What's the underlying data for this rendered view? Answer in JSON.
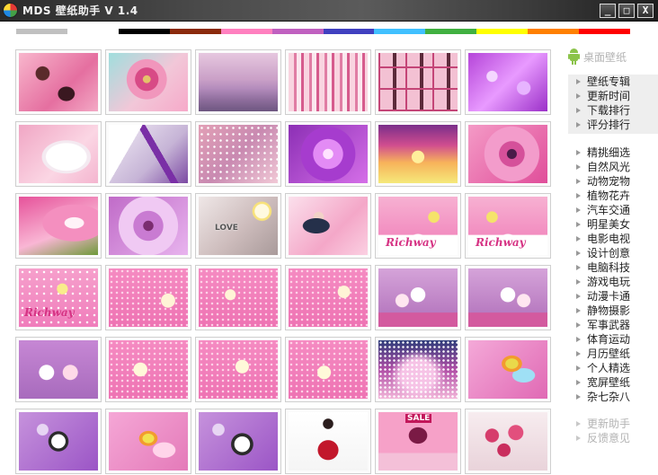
{
  "window": {
    "title": "MDS 壁纸助手 V 1.4",
    "controls": [
      "_",
      "□",
      "X"
    ]
  },
  "color_filter": [
    "#c0c0c0",
    "#ffffff",
    "#000000",
    "#8b2a0c",
    "#ff80bf",
    "#c060c0",
    "#4040c0",
    "#40c0ff",
    "#40b040",
    "#ffff00",
    "#ff8000",
    "#ff0000"
  ],
  "grid": {
    "rows": [
      [
        "pink-model-lying",
        "pink-gerbera-on-teal",
        "misty-purple-landscape",
        "girl-group-collage",
        "girl-group-grid",
        "purple-flowers-bokeh"
      ],
      [
        "white-kitten-on-pink",
        "purple-arrow-abstract",
        "pink-dotted-texture",
        "purple-flower-burst",
        "fairy-in-sunset",
        "pink-daisy-closeup"
      ],
      [
        "pink-calla-lily",
        "purple-daisy-closeup",
        "love-dice-flowers",
        "girl-portrait-pink",
        "richway-cartoon-pink",
        "richway-cartoon-pink-2"
      ],
      [
        "richway-cartoon-scene",
        "pink-bear-pattern",
        "pink-bear-pattern-2",
        "pink-bear-pattern-3",
        "bear-cartoon-purple",
        "bear-cartoon-purple-2"
      ],
      [
        "bears-on-purple",
        "bears-on-pink",
        "bears-on-pink-2",
        "bears-on-pink-3",
        "pink-sparkle-dots",
        "fairy-on-dragonfly"
      ],
      [
        "cartoon-dog-purple",
        "fairy-on-dragonfly-2",
        "cartoon-dog-purple-2",
        "lady-in-red-dress",
        "pink-group-poster",
        "pink-roses-bouquet"
      ]
    ],
    "texts": {
      "richway": "Richway",
      "love": "LOVE",
      "sale": "SALE"
    }
  },
  "sidebar": {
    "desktop_label": "桌面壁纸",
    "top_menu": [
      "壁纸专辑",
      "更新时间",
      "下载排行",
      "评分排行"
    ],
    "categories": [
      "精挑细选",
      "自然风光",
      "动物宠物",
      "植物花卉",
      "汽车交通",
      "明星美女",
      "电影电视",
      "设计创意",
      "电脑科技",
      "游戏电玩",
      "动漫卡通",
      "静物摄影",
      "军事武器",
      "体育运动",
      "月历壁纸",
      "个人精选",
      "宽屏壁纸",
      "杂七杂八"
    ],
    "tools": [
      "更新助手",
      "反馈意见"
    ]
  }
}
